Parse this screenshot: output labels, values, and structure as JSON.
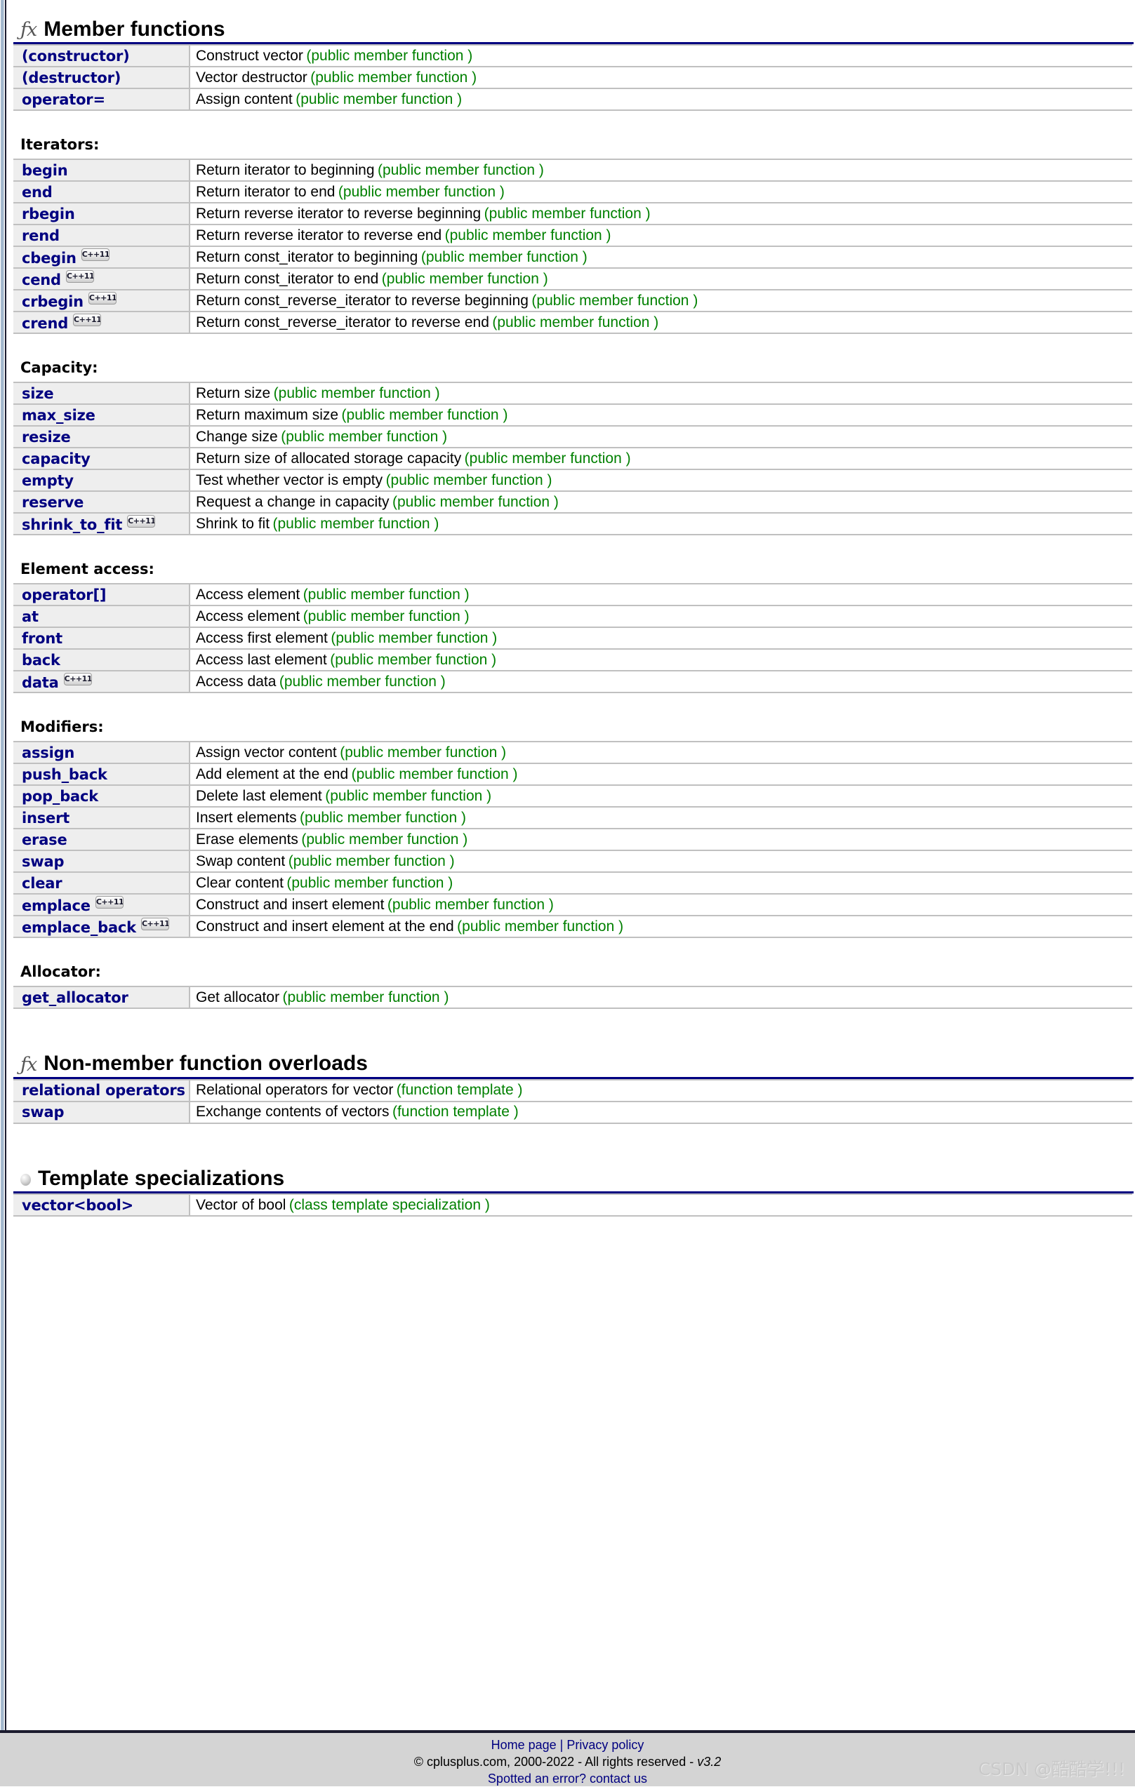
{
  "page": {
    "watermark": "CSDN @酷酷学!!!"
  },
  "sections": [
    {
      "id": "member-functions",
      "icon": "fx-icon",
      "icon_glyph": "ƒx",
      "title": "Member functions"
    },
    {
      "id": "non-member-function-overloads",
      "icon": "fx-icon",
      "icon_glyph": "ƒx",
      "title": "Non-member function overloads"
    },
    {
      "id": "template-specializations",
      "icon": "sphere-icon",
      "title": "Template specializations"
    }
  ],
  "groups": {
    "iterators": "Iterators:",
    "capacity": "Capacity:",
    "element_access": "Element access:",
    "modifiers": "Modifiers:",
    "allocator": "Allocator:"
  },
  "badge": {
    "cpp11": "C++11"
  },
  "tables": {
    "ctor": [
      {
        "name": "(constructor)",
        "badge": false,
        "desc": "Construct vector",
        "kind": "(public member function )"
      },
      {
        "name": "(destructor)",
        "badge": false,
        "desc": "Vector destructor",
        "kind": "(public member function )"
      },
      {
        "name": "operator=",
        "badge": false,
        "desc": "Assign content",
        "kind": "(public member function )"
      }
    ],
    "iterators": [
      {
        "name": "begin",
        "badge": false,
        "desc": "Return iterator to beginning",
        "kind": "(public member function )"
      },
      {
        "name": "end",
        "badge": false,
        "desc": "Return iterator to end",
        "kind": "(public member function )"
      },
      {
        "name": "rbegin",
        "badge": false,
        "desc": "Return reverse iterator to reverse beginning",
        "kind": "(public member function )"
      },
      {
        "name": "rend",
        "badge": false,
        "desc": "Return reverse iterator to reverse end",
        "kind": "(public member function )"
      },
      {
        "name": "cbegin",
        "badge": true,
        "desc": "Return const_iterator to beginning",
        "kind": "(public member function )"
      },
      {
        "name": "cend",
        "badge": true,
        "desc": "Return const_iterator to end",
        "kind": "(public member function )"
      },
      {
        "name": "crbegin",
        "badge": true,
        "desc": "Return const_reverse_iterator to reverse beginning",
        "kind": "(public member function )"
      },
      {
        "name": "crend",
        "badge": true,
        "desc": "Return const_reverse_iterator to reverse end",
        "kind": "(public member function )"
      }
    ],
    "capacity": [
      {
        "name": "size",
        "badge": false,
        "desc": "Return size",
        "kind": "(public member function )"
      },
      {
        "name": "max_size",
        "badge": false,
        "desc": "Return maximum size",
        "kind": "(public member function )"
      },
      {
        "name": "resize",
        "badge": false,
        "desc": "Change size",
        "kind": "(public member function )"
      },
      {
        "name": "capacity",
        "badge": false,
        "desc": "Return size of allocated storage capacity",
        "kind": "(public member function )"
      },
      {
        "name": "empty",
        "badge": false,
        "desc": "Test whether vector is empty",
        "kind": "(public member function )"
      },
      {
        "name": "reserve",
        "badge": false,
        "desc": "Request a change in capacity",
        "kind": "(public member function )"
      },
      {
        "name": "shrink_to_fit",
        "badge": true,
        "desc": "Shrink to fit",
        "kind": "(public member function )"
      }
    ],
    "element_access": [
      {
        "name": "operator[]",
        "badge": false,
        "desc": "Access element",
        "kind": "(public member function )"
      },
      {
        "name": "at",
        "badge": false,
        "desc": "Access element",
        "kind": "(public member function )"
      },
      {
        "name": "front",
        "badge": false,
        "desc": "Access first element",
        "kind": "(public member function )"
      },
      {
        "name": "back",
        "badge": false,
        "desc": "Access last element",
        "kind": "(public member function )"
      },
      {
        "name": "data",
        "badge": true,
        "desc": "Access data",
        "kind": "(public member function )"
      }
    ],
    "modifiers": [
      {
        "name": "assign",
        "badge": false,
        "desc": "Assign vector content",
        "kind": "(public member function )"
      },
      {
        "name": "push_back",
        "badge": false,
        "desc": "Add element at the end",
        "kind": "(public member function )"
      },
      {
        "name": "pop_back",
        "badge": false,
        "desc": "Delete last element",
        "kind": "(public member function )"
      },
      {
        "name": "insert",
        "badge": false,
        "desc": "Insert elements",
        "kind": "(public member function )"
      },
      {
        "name": "erase",
        "badge": false,
        "desc": "Erase elements",
        "kind": "(public member function )"
      },
      {
        "name": "swap",
        "badge": false,
        "desc": "Swap content",
        "kind": "(public member function )"
      },
      {
        "name": "clear",
        "badge": false,
        "desc": "Clear content",
        "kind": "(public member function )"
      },
      {
        "name": "emplace",
        "badge": true,
        "desc": "Construct and insert element",
        "kind": "(public member function )"
      },
      {
        "name": "emplace_back",
        "badge": true,
        "desc": "Construct and insert element at the end",
        "kind": "(public member function )"
      }
    ],
    "allocator": [
      {
        "name": "get_allocator",
        "badge": false,
        "desc": "Get allocator",
        "kind": "(public member function )"
      }
    ],
    "nonmember": [
      {
        "name": "relational operators",
        "badge": false,
        "desc": "Relational operators for vector",
        "kind": "(function template )"
      },
      {
        "name": "swap",
        "badge": false,
        "desc": "Exchange contents of vectors",
        "kind": "(function template )"
      }
    ],
    "specializations": [
      {
        "name": "vector<bool>",
        "badge": false,
        "desc": "Vector of bool",
        "kind": "(class template specialization )"
      }
    ]
  },
  "footer": {
    "home_page": "Home page",
    "separator": "|",
    "privacy_policy": "Privacy policy",
    "copyright": "© cplusplus.com, 2000-2022 - All rights reserved - ",
    "version": "v3.2",
    "spotted": "Spotted an error? contact us"
  }
}
